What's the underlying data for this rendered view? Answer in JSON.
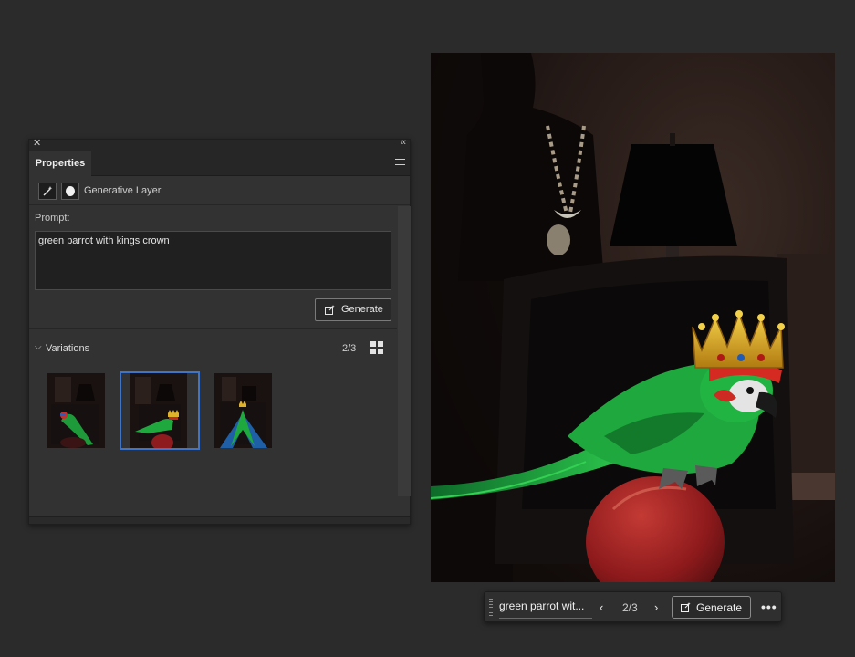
{
  "panel": {
    "tab_label": "Properties",
    "layer_type": "Generative Layer",
    "prompt_label": "Prompt:",
    "prompt_value": "green parrot with kings crown",
    "generate_label": "Generate",
    "variations_label": "Variations",
    "variations_count": "2/3",
    "variations": [
      {
        "name": "variation-1",
        "selected": false
      },
      {
        "name": "variation-2",
        "selected": true
      },
      {
        "name": "variation-3",
        "selected": false
      }
    ]
  },
  "taskbar": {
    "prompt_text": "green parrot wit...",
    "count": "2/3",
    "generate_label": "Generate"
  },
  "colors": {
    "selection": "#3f74c9",
    "panel_bg": "#323232",
    "app_bg": "#2b2b2b",
    "parrot_green": "#1fa83e",
    "crown_gold": "#e0b22a",
    "ball_red": "#9e1d1f"
  }
}
